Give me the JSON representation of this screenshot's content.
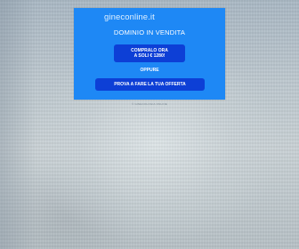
{
  "domain": "gineconline.it",
  "heading": "DOMINIO IN VENDITA",
  "buy_button": {
    "line1": "COMPRALO ORA",
    "line2": "A SOLI € 1280!"
  },
  "or_label": "OPPURE",
  "offer_button": "PROVA A FARE LA TUA OFFERTA",
  "footnote": "© GINECOLOGIA ONLINE",
  "colors": {
    "card": "#1e88f5",
    "button": "#0d3fd6",
    "text": "#ffffff"
  }
}
